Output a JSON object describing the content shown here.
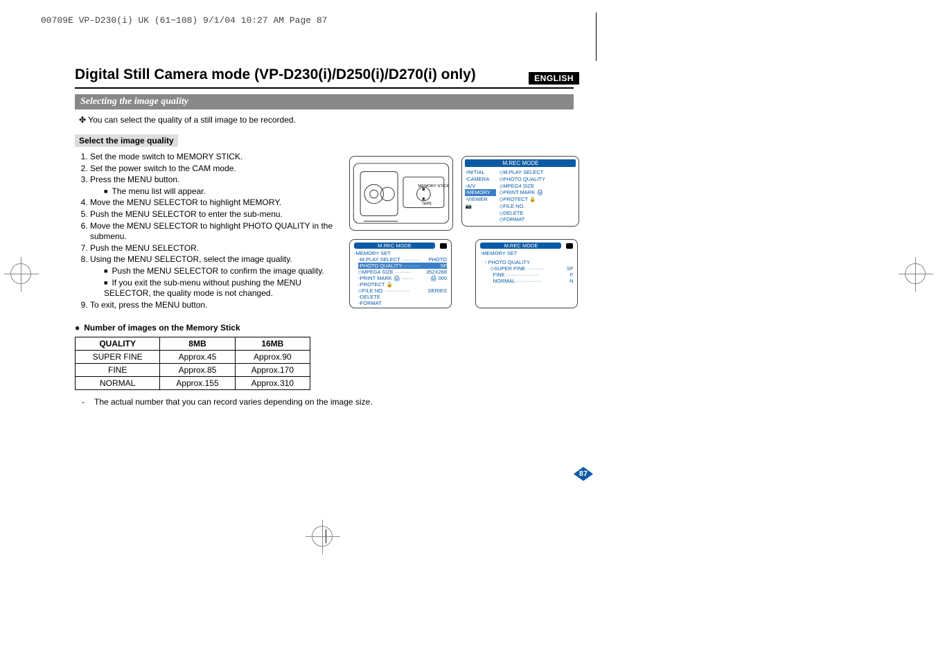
{
  "pageHeader": "00709E VP-D230(i) UK (61~108)  9/1/04 10:27 AM  Page 87",
  "languageBadge": "ENGLISH",
  "docTitle": "Digital Still Camera mode (VP-D230(i)/D250(i)/D270(i) only)",
  "sectionBanner": "Selecting the image quality",
  "introLine": "✤  You can select the quality of a still image to be recorded.",
  "subHeader": "Select the image quality",
  "steps": {
    "s1": "Set the mode switch to MEMORY STICK.",
    "s2": "Set the power switch to the CAM mode.",
    "s3": "Press the MENU button.",
    "s3a": "The menu list will appear.",
    "s4": "Move the MENU SELECTOR to highlight MEMORY.",
    "s5": "Push the MENU SELECTOR to enter the sub-menu.",
    "s6": "Move the MENU SELECTOR to highlight PHOTO QUALITY in the submenu.",
    "s7": "Push the MENU SELECTOR.",
    "s8": "Using the MENU SELECTOR, select the image quality.",
    "s8a": "Push the MENU SELECTOR to confirm the image quality.",
    "s8b": "If you exit the sub-menu without pushing the MENU SELECTOR, the quality mode is not changed.",
    "s9": "To exit, press the MENU button."
  },
  "tableCaption": "Number of images on the Memory Stick",
  "table": {
    "h1": "QUALITY",
    "h2": "8MB",
    "h3": "16MB",
    "r1c1": "SUPER FINE",
    "r1c2": "Approx.45",
    "r1c3": "Approx.90",
    "r2c1": "FINE",
    "r2c2": "Approx.85",
    "r2c3": "Approx.170",
    "r3c1": "NORMAL",
    "r3c2": "Approx.155",
    "r3c3": "Approx.310"
  },
  "footnote": "The actual number that you can record varies depending on the image size.",
  "pageNumber": "87",
  "cameraLabels": {
    "memoryStick": "MEMORY STICK",
    "tape": "TAPE"
  },
  "osd1": {
    "title": "M.REC MODE",
    "leftCol": {
      "i1": "INITIAL",
      "i2": "CAMERA",
      "i3": "A/V",
      "i4": "MEMORY",
      "i5": "VIEWER"
    },
    "rightCol": {
      "i1": "M.PLAY SELECT",
      "i2": "PHOTO QUALITY",
      "i3": "MPEG4 SIZE",
      "i4": "PRINT MARK",
      "i5": "PROTECT",
      "i6": "FILE NO.",
      "i7": "DELETE",
      "i8": "FORMAT"
    }
  },
  "osd2": {
    "title": "M.REC MODE",
    "subtitle": "MEMORY SET",
    "rows": {
      "r1l": "M.PLAY SELECT",
      "r1r": "PHOTO",
      "r2l": "PHOTO QUALITY",
      "r2r": "SF",
      "r3l": "MPEG4 SIZE",
      "r3r": "352X288",
      "r4l": "PRINT MARK",
      "r4r": "000",
      "r5l": "PROTECT",
      "r5r": "",
      "r6l": "FILE NO.",
      "r6r": "SERIES",
      "r7l": "DELETE",
      "r7r": "",
      "r8l": "FORMAT",
      "r8r": ""
    }
  },
  "osd3": {
    "title": "M.REC MODE",
    "subtitle": "MEMORY SET",
    "heading": "PHOTO QUALITY",
    "rows": {
      "r1l": "SUPER FINE",
      "r1r": "SF",
      "r2l": "FINE",
      "r2r": "F",
      "r3l": "NORMAL",
      "r3r": "N"
    }
  }
}
